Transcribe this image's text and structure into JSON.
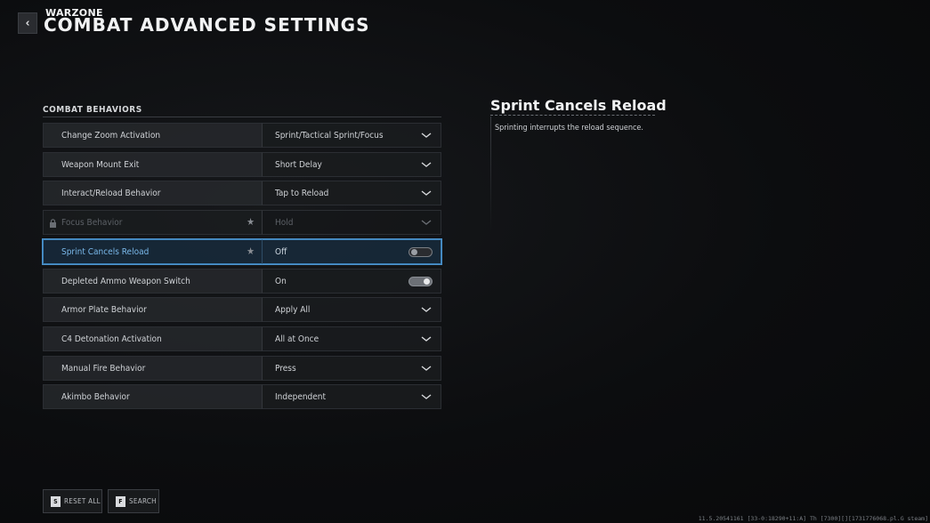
{
  "header": {
    "back_icon": "chevron-left-icon",
    "brand": "WARZONE",
    "title": "COMBAT ADVANCED SETTINGS"
  },
  "section": {
    "title": "COMBAT BEHAVIORS"
  },
  "rows": [
    {
      "label": "Change Zoom Activation",
      "value": "Sprint/Tactical Sprint/Focus",
      "control": "dropdown"
    },
    {
      "label": "Weapon Mount Exit",
      "value": "Short Delay",
      "control": "dropdown"
    },
    {
      "label": "Interact/Reload Behavior",
      "value": "Tap to Reload",
      "control": "dropdown"
    },
    {
      "label": "Focus Behavior",
      "value": "Hold",
      "control": "dropdown",
      "locked": true,
      "starred": true
    },
    {
      "label": "Sprint Cancels Reload",
      "value": "Off",
      "control": "toggle",
      "toggle_on": false,
      "selected": true,
      "starred": true
    },
    {
      "label": "Depleted Ammo Weapon Switch",
      "value": "On",
      "control": "toggle",
      "toggle_on": true
    },
    {
      "label": "Armor Plate Behavior",
      "value": "Apply All",
      "control": "dropdown"
    },
    {
      "label": "C4 Detonation Activation",
      "value": "All at Once",
      "control": "dropdown"
    },
    {
      "label": "Manual Fire Behavior",
      "value": "Press",
      "control": "dropdown"
    },
    {
      "label": "Akimbo Behavior",
      "value": "Independent",
      "control": "dropdown"
    }
  ],
  "detail": {
    "title": "Sprint Cancels Reload",
    "description": "Sprinting interrupts the reload sequence."
  },
  "footer": {
    "reset": {
      "key": "S",
      "label": "RESET ALL"
    },
    "search": {
      "key": "F",
      "label": "SEARCH"
    },
    "version": "11.5.20541161 [33-0:18290+11:A] Th [7300][][1731776068.pl.G steam]"
  },
  "colors": {
    "accent": "#4c93cc",
    "selected_label": "#7ab8ea",
    "background": "#0b0c0e"
  }
}
